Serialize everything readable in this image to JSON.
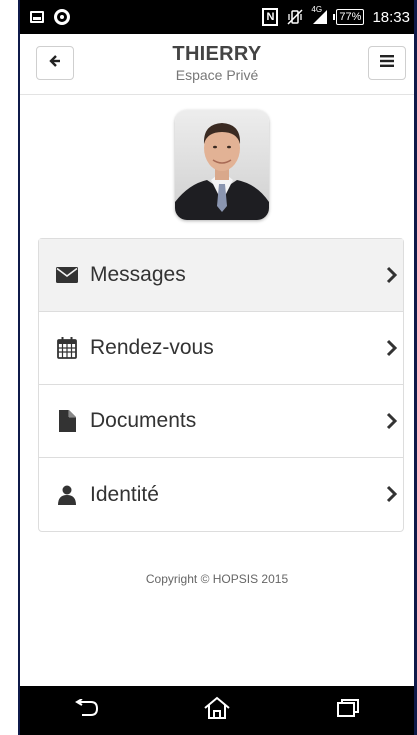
{
  "status_bar": {
    "nfc_label": "N",
    "network_label": "4G",
    "battery_level": "77%",
    "time": "18:33"
  },
  "header": {
    "title": "THIERRY",
    "subtitle": "Espace Privé",
    "back_icon": "arrow-left-icon",
    "menu_icon": "hamburger-menu-icon"
  },
  "profile": {
    "avatar_icon": "user-photo"
  },
  "menu": {
    "items": [
      {
        "label": "Messages",
        "icon": "envelope-icon"
      },
      {
        "label": "Rendez-vous",
        "icon": "calendar-icon"
      },
      {
        "label": "Documents",
        "icon": "document-icon"
      },
      {
        "label": "Identité",
        "icon": "user-icon"
      }
    ]
  },
  "footer": {
    "copyright": "Copyright © HOPSIS 2015"
  },
  "colors": {
    "status_bar_bg": "#000000",
    "active_row_bg": "#f2f2f2",
    "text": "#333333"
  }
}
